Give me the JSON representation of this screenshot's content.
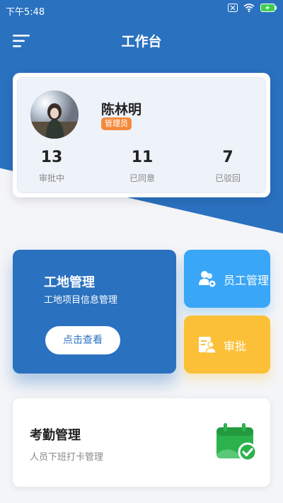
{
  "statusbar": {
    "time": "下午5:48"
  },
  "header": {
    "title": "工作台"
  },
  "profile": {
    "name": "陈林明",
    "role": "管理员",
    "stats": [
      {
        "value": "13",
        "label": "审批中"
      },
      {
        "value": "11",
        "label": "已同意"
      },
      {
        "value": "7",
        "label": "已驳回"
      }
    ]
  },
  "site_card": {
    "title": "工地管理",
    "subtitle": "工地项目信息管理",
    "button": "点击查看"
  },
  "staff_card": {
    "label": "员工管理",
    "icon": "users-gear-icon"
  },
  "approve_card": {
    "label": "审批",
    "icon": "approval-person-icon"
  },
  "attendance_card": {
    "title": "考勤管理",
    "subtitle": "人员下班打卡管理",
    "icon": "calendar-check-icon"
  },
  "colors": {
    "primary": "#2a71c0",
    "orange": "#f58a3c",
    "sky": "#3aa6f7",
    "amber": "#fcc038",
    "green": "#2bb24c"
  }
}
